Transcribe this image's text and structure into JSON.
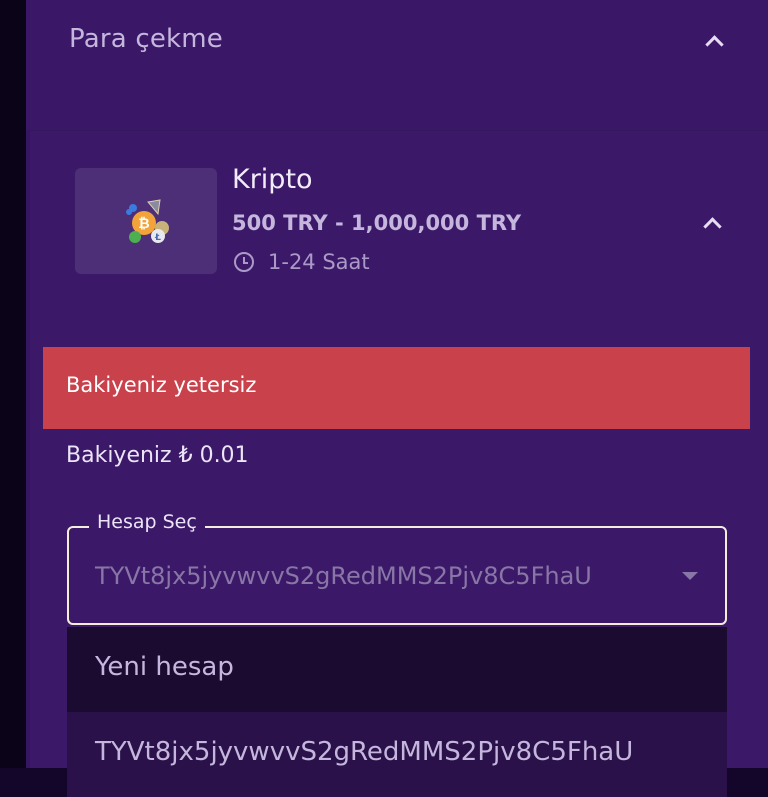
{
  "section": {
    "title": "Para çekme"
  },
  "method": {
    "name": "Kripto",
    "limits": "500 TRY - 1,000,000 TRY",
    "time": "1-24 Saat"
  },
  "alert": {
    "message": "Bakiyeniz yetersiz"
  },
  "balance": {
    "text": "Bakiyeniz ₺ 0.01"
  },
  "account_select": {
    "label": "Hesap Seç",
    "selected_value": "TYVt8jx5jyvwvvS2gRedMMS2Pjv8C5FhaU",
    "options": [
      "Yeni hesap",
      "TYVt8jx5jyvwvvS2gRedMMS2Pjv8C5FhaU"
    ]
  },
  "colors": {
    "panel_bg": "#351660",
    "card_bg": "#3b1968",
    "alert_bg": "#c9414b",
    "dropdown_bg": "#1c0b30",
    "dropdown_highlight": "#2a1149"
  },
  "icons": {
    "collapse": "chevron-up-icon",
    "time": "clock-icon",
    "method_logo": "crypto-coins-icon",
    "select": "caret-down-icon"
  }
}
